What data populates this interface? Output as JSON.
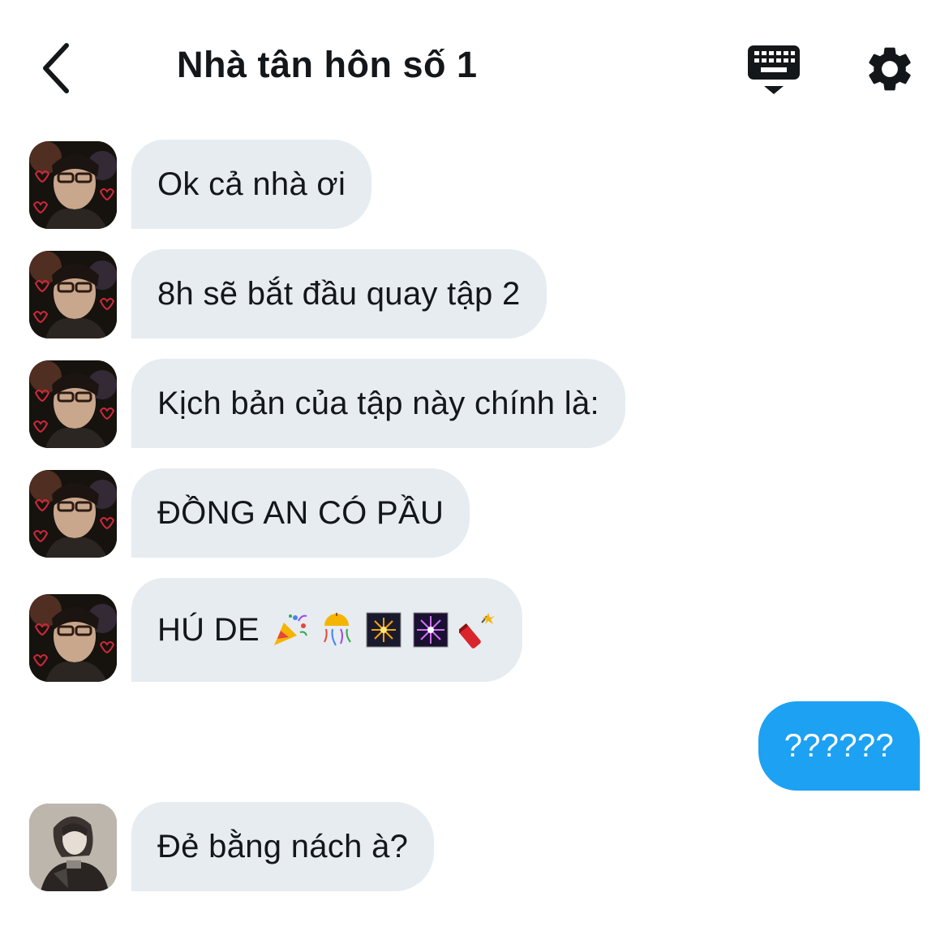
{
  "header": {
    "title": "Nhà tân hôn số 1",
    "back_icon": "chevron-left-icon",
    "keyboard_icon": "keyboard-icon",
    "settings_icon": "gear-icon"
  },
  "colors": {
    "received_bubble": "#e6ecf0",
    "sent_bubble": "#1da1f2",
    "text": "#14171a"
  },
  "messages": [
    {
      "sender": "other",
      "text": "Ok cả nhà ơi"
    },
    {
      "sender": "other",
      "text": "8h sẽ bắt đầu quay tập 2"
    },
    {
      "sender": "other",
      "text": "Kịch bản của tập này chính là:"
    },
    {
      "sender": "other",
      "text": "ĐỒNG AN CÓ PẦU"
    },
    {
      "sender": "other",
      "text": "HÚ DE",
      "emojis": [
        "party-popper-icon",
        "confetti-ball-icon",
        "fireworks-icon",
        "sparkler-icon",
        "firecracker-icon"
      ]
    },
    {
      "sender": "me",
      "text": "??????"
    },
    {
      "sender": "other2",
      "text": "Đẻ bằng nách à?"
    }
  ]
}
